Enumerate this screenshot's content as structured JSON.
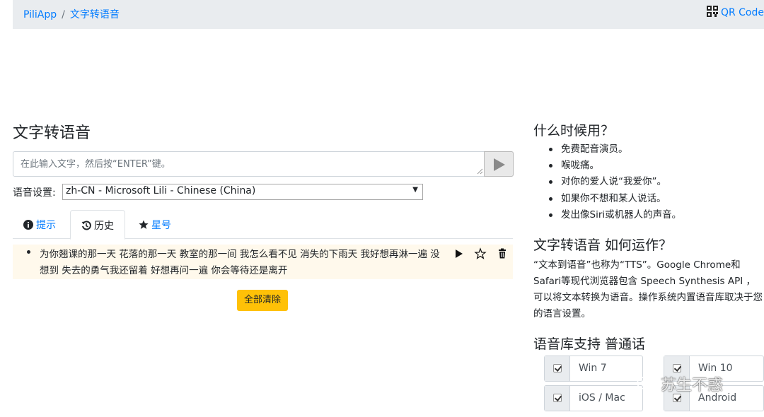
{
  "breadcrumb": {
    "home": "PiliApp",
    "separator": "/",
    "current": "文字转语音"
  },
  "header": {
    "qr_label": "QR Code",
    "qr_icon": "qrcode-icon"
  },
  "main": {
    "title": "文字转语音",
    "input": {
      "placeholder": "在此输入文字，然后按“ENTER”键。",
      "value": ""
    },
    "play_icon": "play-icon",
    "voice_label": "语音设置:",
    "voice_selected": "zh-CN - Microsoft Lili - Chinese (China)",
    "tabs": [
      {
        "label": "提示",
        "icon": "info-icon"
      },
      {
        "label": "历史",
        "icon": "history-icon",
        "active": true
      },
      {
        "label": "星号",
        "icon": "star-icon"
      }
    ],
    "history": [
      {
        "text": "为你翘课的那一天 花落的那一天 教室的那一间 我怎么看不见 消失的下雨天 我好想再淋一遍 没想到 失去的勇气我还留着 好想再问一遍 你会等待还是离开"
      }
    ],
    "clear_label": "全部清除"
  },
  "sidebar": {
    "when_title": "什么时候用？",
    "uses": [
      "免费配音演员。",
      "喉咙痛。",
      "对你的爱人说“我爱你”。",
      "如果你不想和某人说话。",
      "发出像Siri或机器人的声音。"
    ],
    "how_title": "文字转语音 如何运作？",
    "how_text": "“文本到语音”也称为“TTS”。Google Chrome和Safari等现代浏览器包含 Speech Synthesis API ，可以将文本转换为语音。操作系统内置语音库取决于您的语言设置。",
    "support_title": "语音库支持 普通话",
    "os": [
      {
        "label": "Win 7",
        "checked": true
      },
      {
        "label": "Win 10",
        "checked": true
      },
      {
        "label": "iOS / Mac",
        "checked": true
      },
      {
        "label": "Android",
        "checked": true
      }
    ]
  },
  "watermark": {
    "text": "苏生不惑"
  },
  "colors": {
    "link": "#007bff",
    "warning": "#ffc107",
    "topbar": "#e9ecef",
    "history_bg": "#fff9ec"
  }
}
